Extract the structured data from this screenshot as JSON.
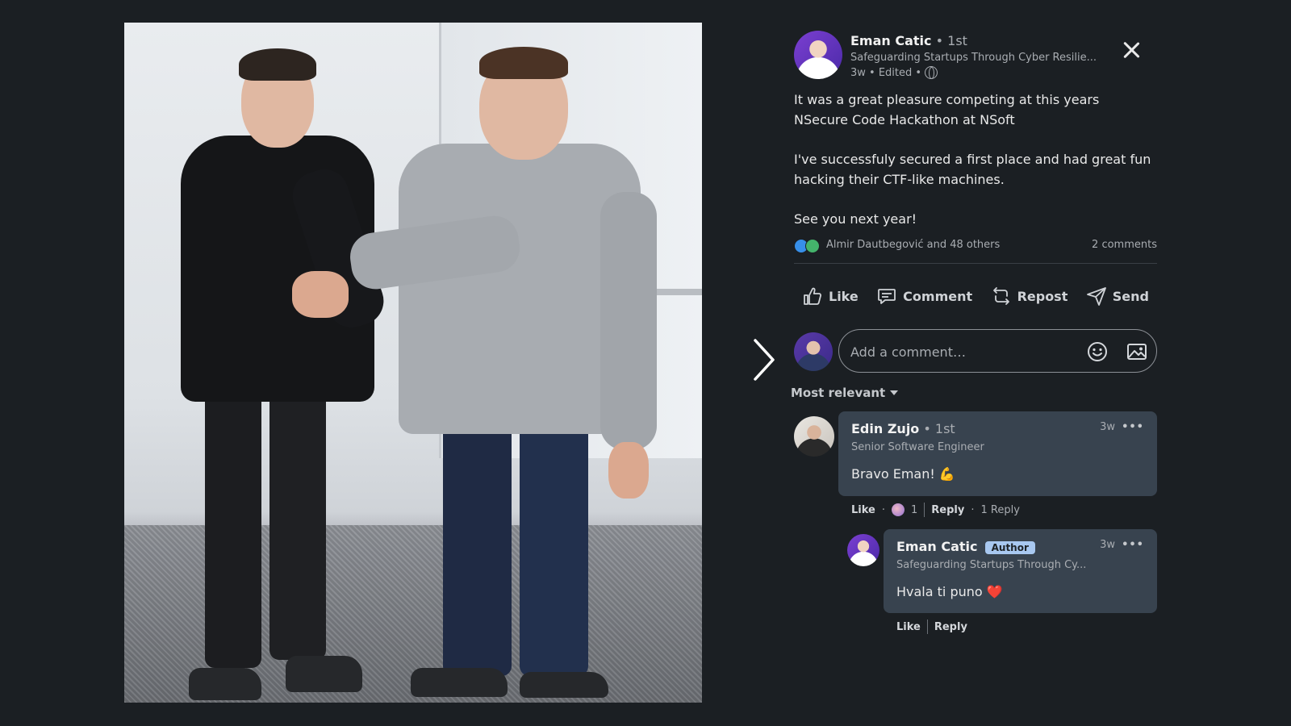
{
  "post": {
    "author": {
      "name": "Eman Catic",
      "degree": "• 1st",
      "headline": "Safeguarding Startups Through Cyber Resilie...",
      "meta": "3w • Edited •"
    },
    "body": [
      "It was a great pleasure competing at this years NSecure Code Hackathon at NSoft",
      "I've successfuly secured a first place and had great fun hacking their CTF-like machines.",
      "See you next year!"
    ],
    "reactions": {
      "reactors": "Almir Dautbegović and 48 others",
      "comments_count": "2 comments"
    },
    "actions": {
      "like": "Like",
      "comment": "Comment",
      "repost": "Repost",
      "send": "Send"
    }
  },
  "comment_box": {
    "placeholder": "Add a comment…"
  },
  "sort": {
    "label": "Most relevant"
  },
  "comments": [
    {
      "name": "Edin Zujo",
      "degree": "• 1st",
      "headline": "Senior Software Engineer",
      "text": "Bravo Eman!",
      "emoji": "💪",
      "time": "3w",
      "more": "•••",
      "like": "Like",
      "reaction_count": "1",
      "reply": "Reply",
      "replies": "1 Reply"
    },
    {
      "name": "Eman Catic",
      "badge": "Author",
      "headline": "Safeguarding Startups Through Cy...",
      "text": "Hvala ti puno",
      "emoji": "❤️",
      "time": "3w",
      "more": "•••",
      "like": "Like",
      "reply": "Reply"
    }
  ],
  "icons": {
    "close": "close-icon",
    "next": "chevron-right-icon",
    "globe": "globe-icon",
    "emoji": "emoji-icon",
    "image": "image-icon"
  },
  "colors": {
    "background": "#1b1f23",
    "bubble": "#38434f",
    "author_badge": "#a8c8f0"
  }
}
